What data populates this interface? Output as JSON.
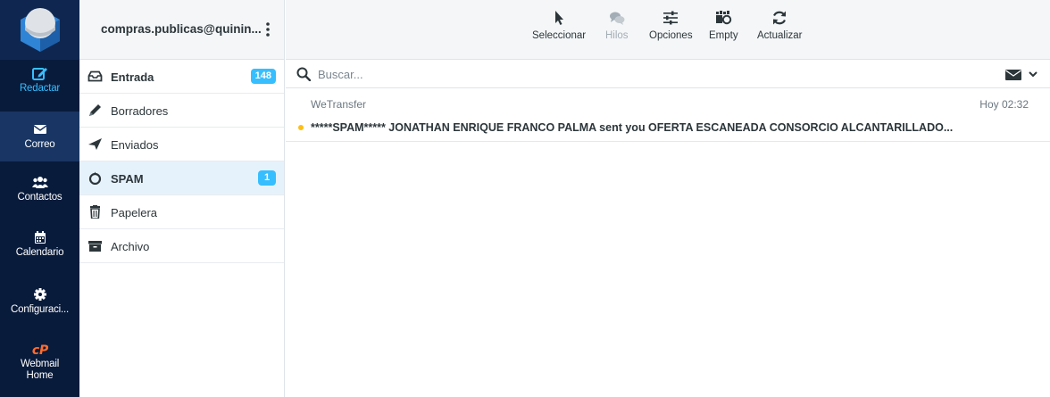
{
  "app": {
    "account": "compras.publicas@quinin..."
  },
  "nav": {
    "items": [
      {
        "label": "Redactar",
        "icon": "compose-icon",
        "state": "active"
      },
      {
        "label": "Correo",
        "icon": "envelope-icon",
        "state": "selected"
      },
      {
        "label": "Contactos",
        "icon": "contacts-icon",
        "state": ""
      },
      {
        "label": "Calendario",
        "icon": "calendar-icon",
        "state": ""
      },
      {
        "label": "Configuraci...",
        "icon": "gear-icon",
        "state": ""
      },
      {
        "label_line1": "Webmail",
        "label_line2": "Home",
        "icon": "cpanel-icon",
        "state": ""
      }
    ]
  },
  "folders": [
    {
      "label": "Entrada",
      "icon": "inbox-icon",
      "badge": "148",
      "bold": true,
      "selected": false
    },
    {
      "label": "Borradores",
      "icon": "pencil-icon",
      "badge": "",
      "bold": false,
      "selected": false
    },
    {
      "label": "Enviados",
      "icon": "paper-plane-icon",
      "badge": "",
      "bold": false,
      "selected": false
    },
    {
      "label": "SPAM",
      "icon": "fire-icon",
      "badge": "1",
      "bold": true,
      "selected": true
    },
    {
      "label": "Papelera",
      "icon": "trash-icon",
      "badge": "",
      "bold": false,
      "selected": false
    },
    {
      "label": "Archivo",
      "icon": "archive-icon",
      "badge": "",
      "bold": false,
      "selected": false
    }
  ],
  "toolbar": {
    "select": "Seleccionar",
    "threads": "Hilos",
    "options": "Opciones",
    "empty": "Empty",
    "refresh": "Actualizar"
  },
  "search": {
    "placeholder": "Buscar...",
    "value": ""
  },
  "messages": [
    {
      "from": "WeTransfer",
      "date": "Hoy 02:32",
      "subject": "*****SPAM***** JONATHAN ENRIQUE FRANCO PALMA sent you OFERTA ESCANEADA CONSORCIO ALCANTARILLADO...",
      "unread": true
    }
  ],
  "colors": {
    "nav_bg": "#081b3b",
    "accent": "#37beff",
    "unread_dot": "#ffbe16"
  }
}
